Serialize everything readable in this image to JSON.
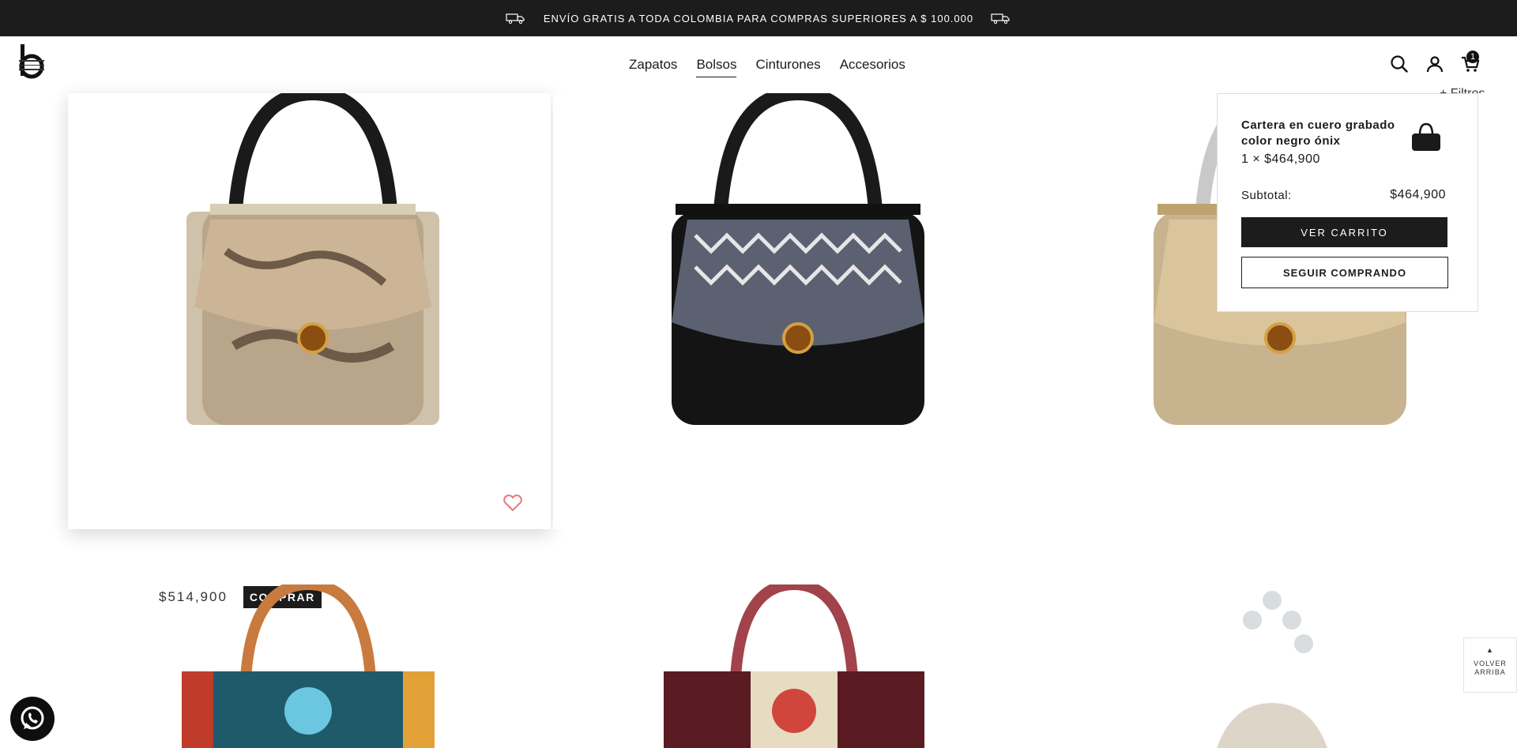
{
  "announcement": {
    "text": "ENVÍO GRATIS A TODA COLOMBIA PARA COMPRAS SUPERIORES A $ 100.000"
  },
  "nav": {
    "items": [
      "Zapatos",
      "Bolsos",
      "Cinturones",
      "Accesorios"
    ],
    "active": "Bolsos"
  },
  "header": {
    "cart_count": "1",
    "filters_label": "+ Filtros"
  },
  "products": [
    {
      "price": "$514,900",
      "buy_label": "COMPRAR"
    }
  ],
  "minicart": {
    "item_name": "Cartera en cuero grabado color negro ónix",
    "item_qty_price": "1 × $464,900",
    "subtotal_label": "Subtotal:",
    "subtotal_value": "$464,900",
    "view_cart_label": "VER CARRITO",
    "continue_label": "SEGUIR COMPRANDO"
  },
  "back_to_top": {
    "line1": "VOLVER",
    "line2": "ARRIBA"
  },
  "icons": {
    "search": "search-icon",
    "account": "user-icon",
    "cart": "cart-icon",
    "wishlist": "heart-icon",
    "whatsapp": "whatsapp-icon"
  },
  "colors": {
    "topbar": "#1c1c1c",
    "heart": "#e9767b"
  }
}
